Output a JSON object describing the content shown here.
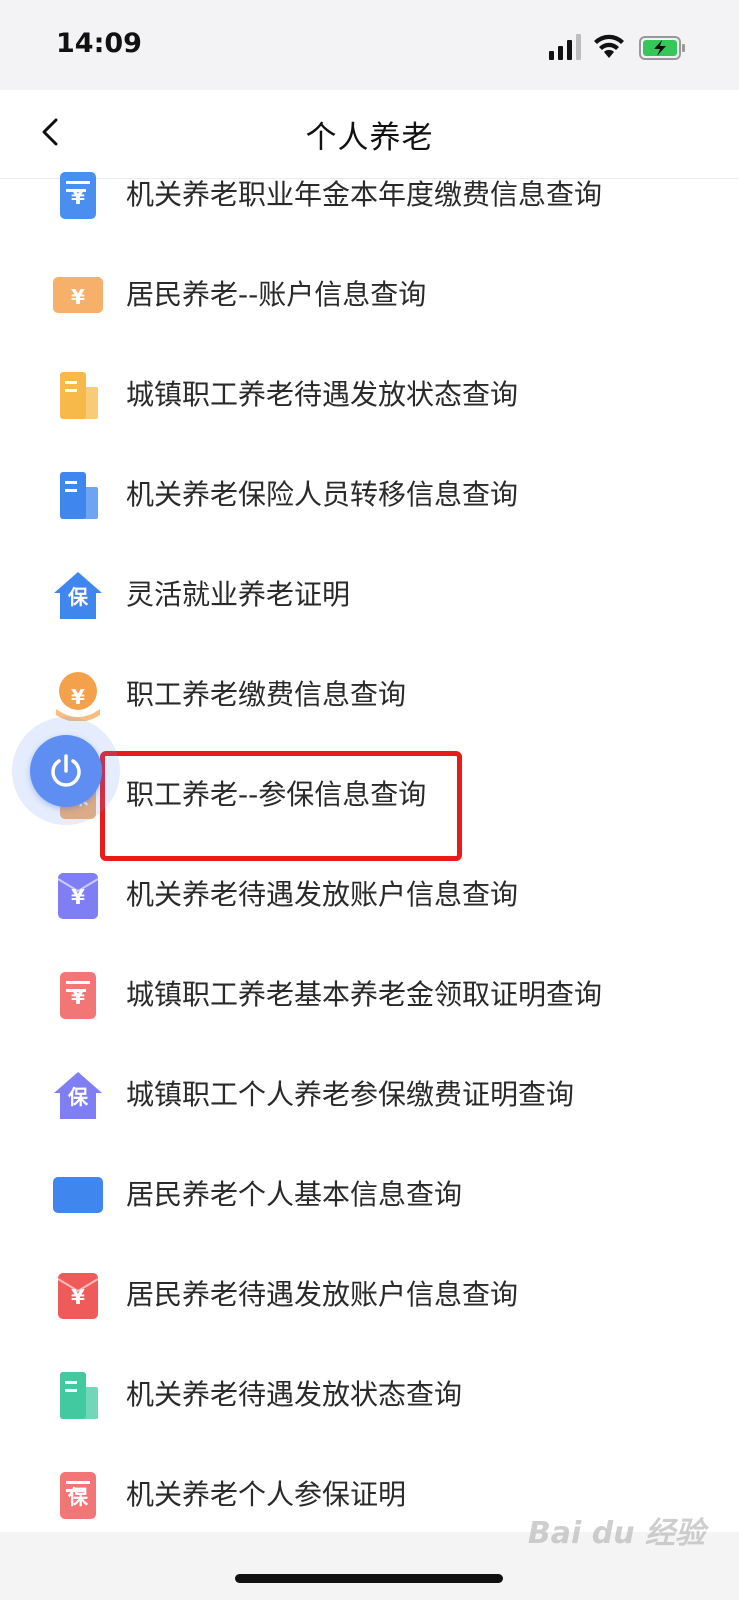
{
  "status_bar": {
    "time": "14:09"
  },
  "nav": {
    "title": "个人养老"
  },
  "items": [
    {
      "label": "机关养老职业年金本年度缴费信息查询",
      "icon": "pension-bill-icon",
      "color": "#4a8ef0",
      "glyph": "¥"
    },
    {
      "label": "居民养老--账户信息查询",
      "icon": "account-card-icon",
      "color": "#f7b06a",
      "glyph": "¥"
    },
    {
      "label": "城镇职工养老待遇发放状态查询",
      "icon": "building-status-icon",
      "color": "#f6b94a",
      "glyph": ""
    },
    {
      "label": "机关养老保险人员转移信息查询",
      "icon": "transfer-building-icon",
      "color": "#3f86ee",
      "glyph": ""
    },
    {
      "label": "灵活就业养老证明",
      "icon": "house-insurance-icon",
      "color": "#3f86ee",
      "glyph": "保"
    },
    {
      "label": "职工养老缴费信息查询",
      "icon": "coin-hand-icon",
      "color": "#f5a04a",
      "glyph": "¥"
    },
    {
      "label": "职工养老--参保信息查询",
      "icon": "insurance-doc-icon",
      "color": "#f5b070",
      "glyph": "保"
    },
    {
      "label": "机关养老待遇发放账户信息查询",
      "icon": "envelope-yuan-icon",
      "color": "#7f7ef5",
      "glyph": "¥"
    },
    {
      "label": "城镇职工养老基本养老金领取证明查询",
      "icon": "certificate-yuan-icon",
      "color": "#f27676",
      "glyph": "¥"
    },
    {
      "label": "城镇职工个人养老参保缴费证明查询",
      "icon": "house-insurance-icon",
      "color": "#7f7ef5",
      "glyph": "保"
    },
    {
      "label": "居民养老个人基本信息查询",
      "icon": "id-card-icon",
      "color": "#3f86ee",
      "glyph": ""
    },
    {
      "label": "居民养老待遇发放账户信息查询",
      "icon": "envelope-yuan-icon",
      "color": "#ef5b5b",
      "glyph": "¥"
    },
    {
      "label": "机关养老待遇发放状态查询",
      "icon": "building-status-icon",
      "color": "#43c9a0",
      "glyph": ""
    },
    {
      "label": "机关养老个人参保证明",
      "icon": "certificate-icon",
      "color": "#f27676",
      "glyph": "保"
    }
  ],
  "watermark": "Bai du 经验"
}
